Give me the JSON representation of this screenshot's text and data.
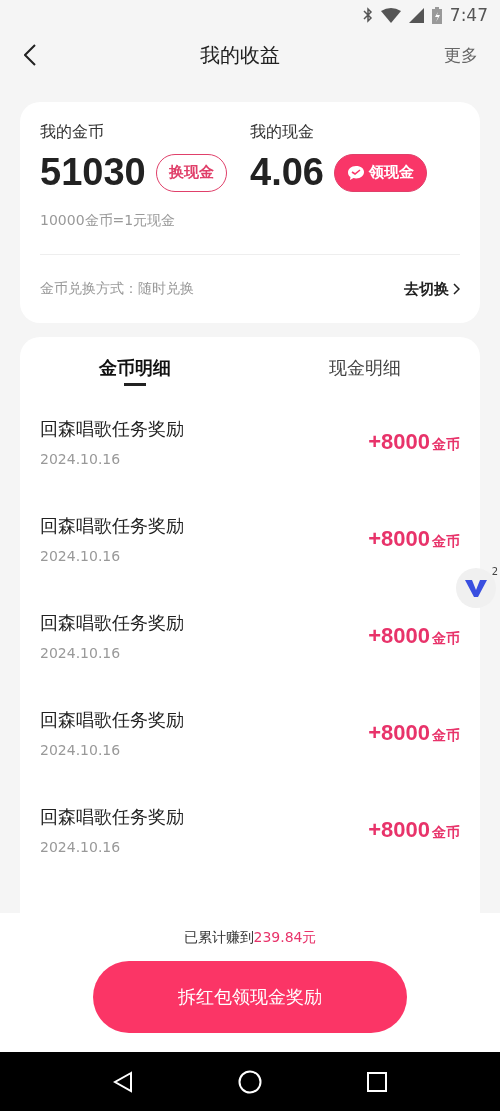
{
  "status_bar": {
    "time": "7:47"
  },
  "header": {
    "title": "我的收益",
    "more": "更多"
  },
  "balance_card": {
    "coins": {
      "label": "我的金币",
      "value": "51030",
      "button": "换现金"
    },
    "cash": {
      "label": "我的现金",
      "value": "4.06",
      "button": "领现金"
    },
    "rate": "10000金币=1元现金",
    "exchange_mode": "金币兑换方式：随时兑换",
    "switch_link": "去切换"
  },
  "tabs": [
    {
      "label": "金币明细",
      "selected": true
    },
    {
      "label": "现金明细",
      "selected": false
    }
  ],
  "records": [
    {
      "title": "回森唱歌任务奖励",
      "date": "2024.10.16",
      "amount": "+8000",
      "unit": "金币"
    },
    {
      "title": "回森唱歌任务奖励",
      "date": "2024.10.16",
      "amount": "+8000",
      "unit": "金币"
    },
    {
      "title": "回森唱歌任务奖励",
      "date": "2024.10.16",
      "amount": "+8000",
      "unit": "金币"
    },
    {
      "title": "回森唱歌任务奖励",
      "date": "2024.10.16",
      "amount": "+8000",
      "unit": "金币"
    },
    {
      "title": "回森唱歌任务奖励",
      "date": "2024.10.16",
      "amount": "+8000",
      "unit": "金币"
    }
  ],
  "floating_badge": {
    "count": "2"
  },
  "footer": {
    "earned_label": "已累计赚到",
    "earned_amount": "239.84元",
    "button": "拆红包领现金奖励"
  }
}
